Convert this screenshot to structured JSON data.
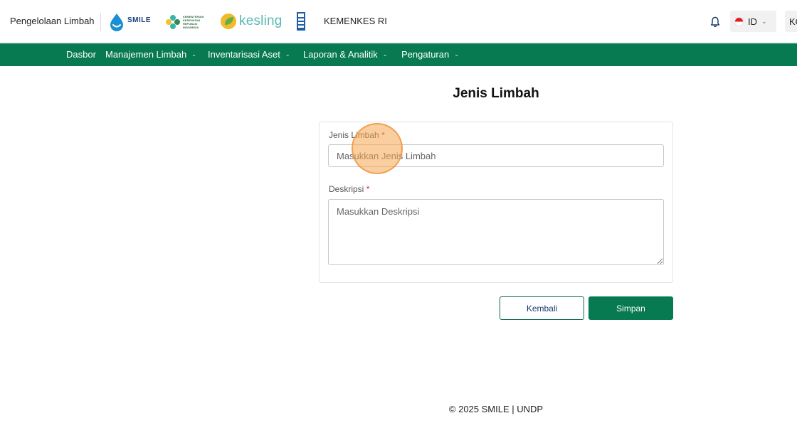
{
  "header": {
    "app_title": "Pengelolaan Limbah",
    "smile_logo_text": "SMILE",
    "kemenkes_logo_lines": [
      "KEMENTERIAN",
      "KESEHATAN",
      "REPUBLIK",
      "INDONESIA"
    ],
    "kesling_logo_text": "kesling",
    "org_name": "KEMENKES RI",
    "language": "ID",
    "user_initials": "KO"
  },
  "nav": {
    "items": [
      {
        "label": "Dasbor",
        "has_dropdown": false
      },
      {
        "label": "Manajemen Limbah",
        "has_dropdown": true
      },
      {
        "label": "Inventarisasi Aset",
        "has_dropdown": true
      },
      {
        "label": "Laporan & Analitik",
        "has_dropdown": true
      },
      {
        "label": "Pengaturan",
        "has_dropdown": true
      }
    ]
  },
  "page": {
    "title": "Jenis Limbah"
  },
  "form": {
    "jenis_limbah": {
      "label": "Jenis Limbah",
      "required_mark": "*",
      "placeholder": "Masukkan Jenis Limbah",
      "value": ""
    },
    "deskripsi": {
      "label": "Deskripsi",
      "required_mark": "*",
      "placeholder": "Masukkan Deskripsi",
      "value": ""
    }
  },
  "actions": {
    "back_label": "Kembali",
    "save_label": "Simpan"
  },
  "footer": {
    "text": "© 2025 SMILE | UNDP"
  },
  "colors": {
    "primary_green": "#087a52",
    "required_red": "#d7262e",
    "click_marker": "#f5a650"
  },
  "icons": {
    "bell": "bell-icon",
    "chevron": "chevron-down-icon"
  }
}
